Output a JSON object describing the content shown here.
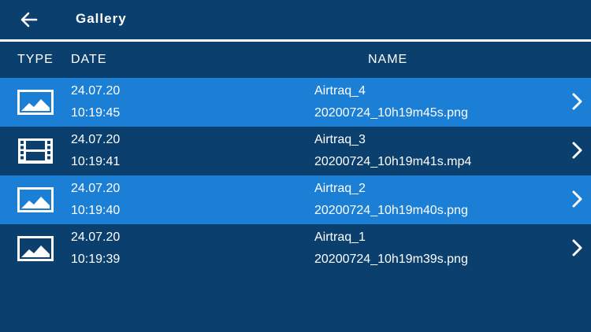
{
  "header": {
    "title": "Gallery",
    "back_icon": "arrow-left-icon"
  },
  "columns": {
    "type": "TYPE",
    "date": "DATE",
    "name": "NAME"
  },
  "colors": {
    "background": "#0b3f6e",
    "row_highlight": "#1b7fd6",
    "text": "#ffffff"
  },
  "items": [
    {
      "type": "image",
      "icon": "image-icon",
      "date": "24.07.20",
      "time": "10:19:45",
      "name": "Airtraq_4",
      "file": "20200724_10h19m45s.png"
    },
    {
      "type": "video",
      "icon": "film-icon",
      "date": "24.07.20",
      "time": "10:19:41",
      "name": "Airtraq_3",
      "file": "20200724_10h19m41s.mp4"
    },
    {
      "type": "image",
      "icon": "image-icon",
      "date": "24.07.20",
      "time": "10:19:40",
      "name": "Airtraq_2",
      "file": "20200724_10h19m40s.png"
    },
    {
      "type": "image",
      "icon": "image-icon",
      "date": "24.07.20",
      "time": "10:19:39",
      "name": "Airtraq_1",
      "file": "20200724_10h19m39s.png"
    }
  ]
}
